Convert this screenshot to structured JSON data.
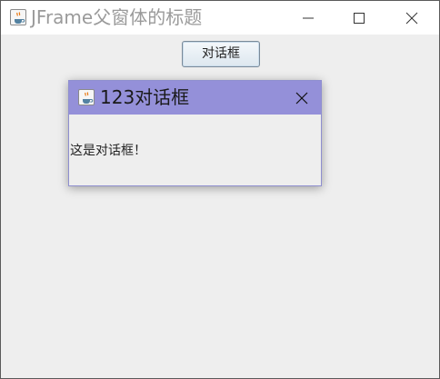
{
  "main_window": {
    "title": "JFrame父窗体的标题",
    "icon": "java-cup-icon",
    "controls": [
      "minimize-icon",
      "maximize-icon",
      "close-icon"
    ],
    "open_dialog_button_label": "对话框"
  },
  "dialog": {
    "title": "123对话框",
    "icon": "java-cup-icon",
    "message": "这是对话框！",
    "titlebar_color": "#9490d9"
  }
}
